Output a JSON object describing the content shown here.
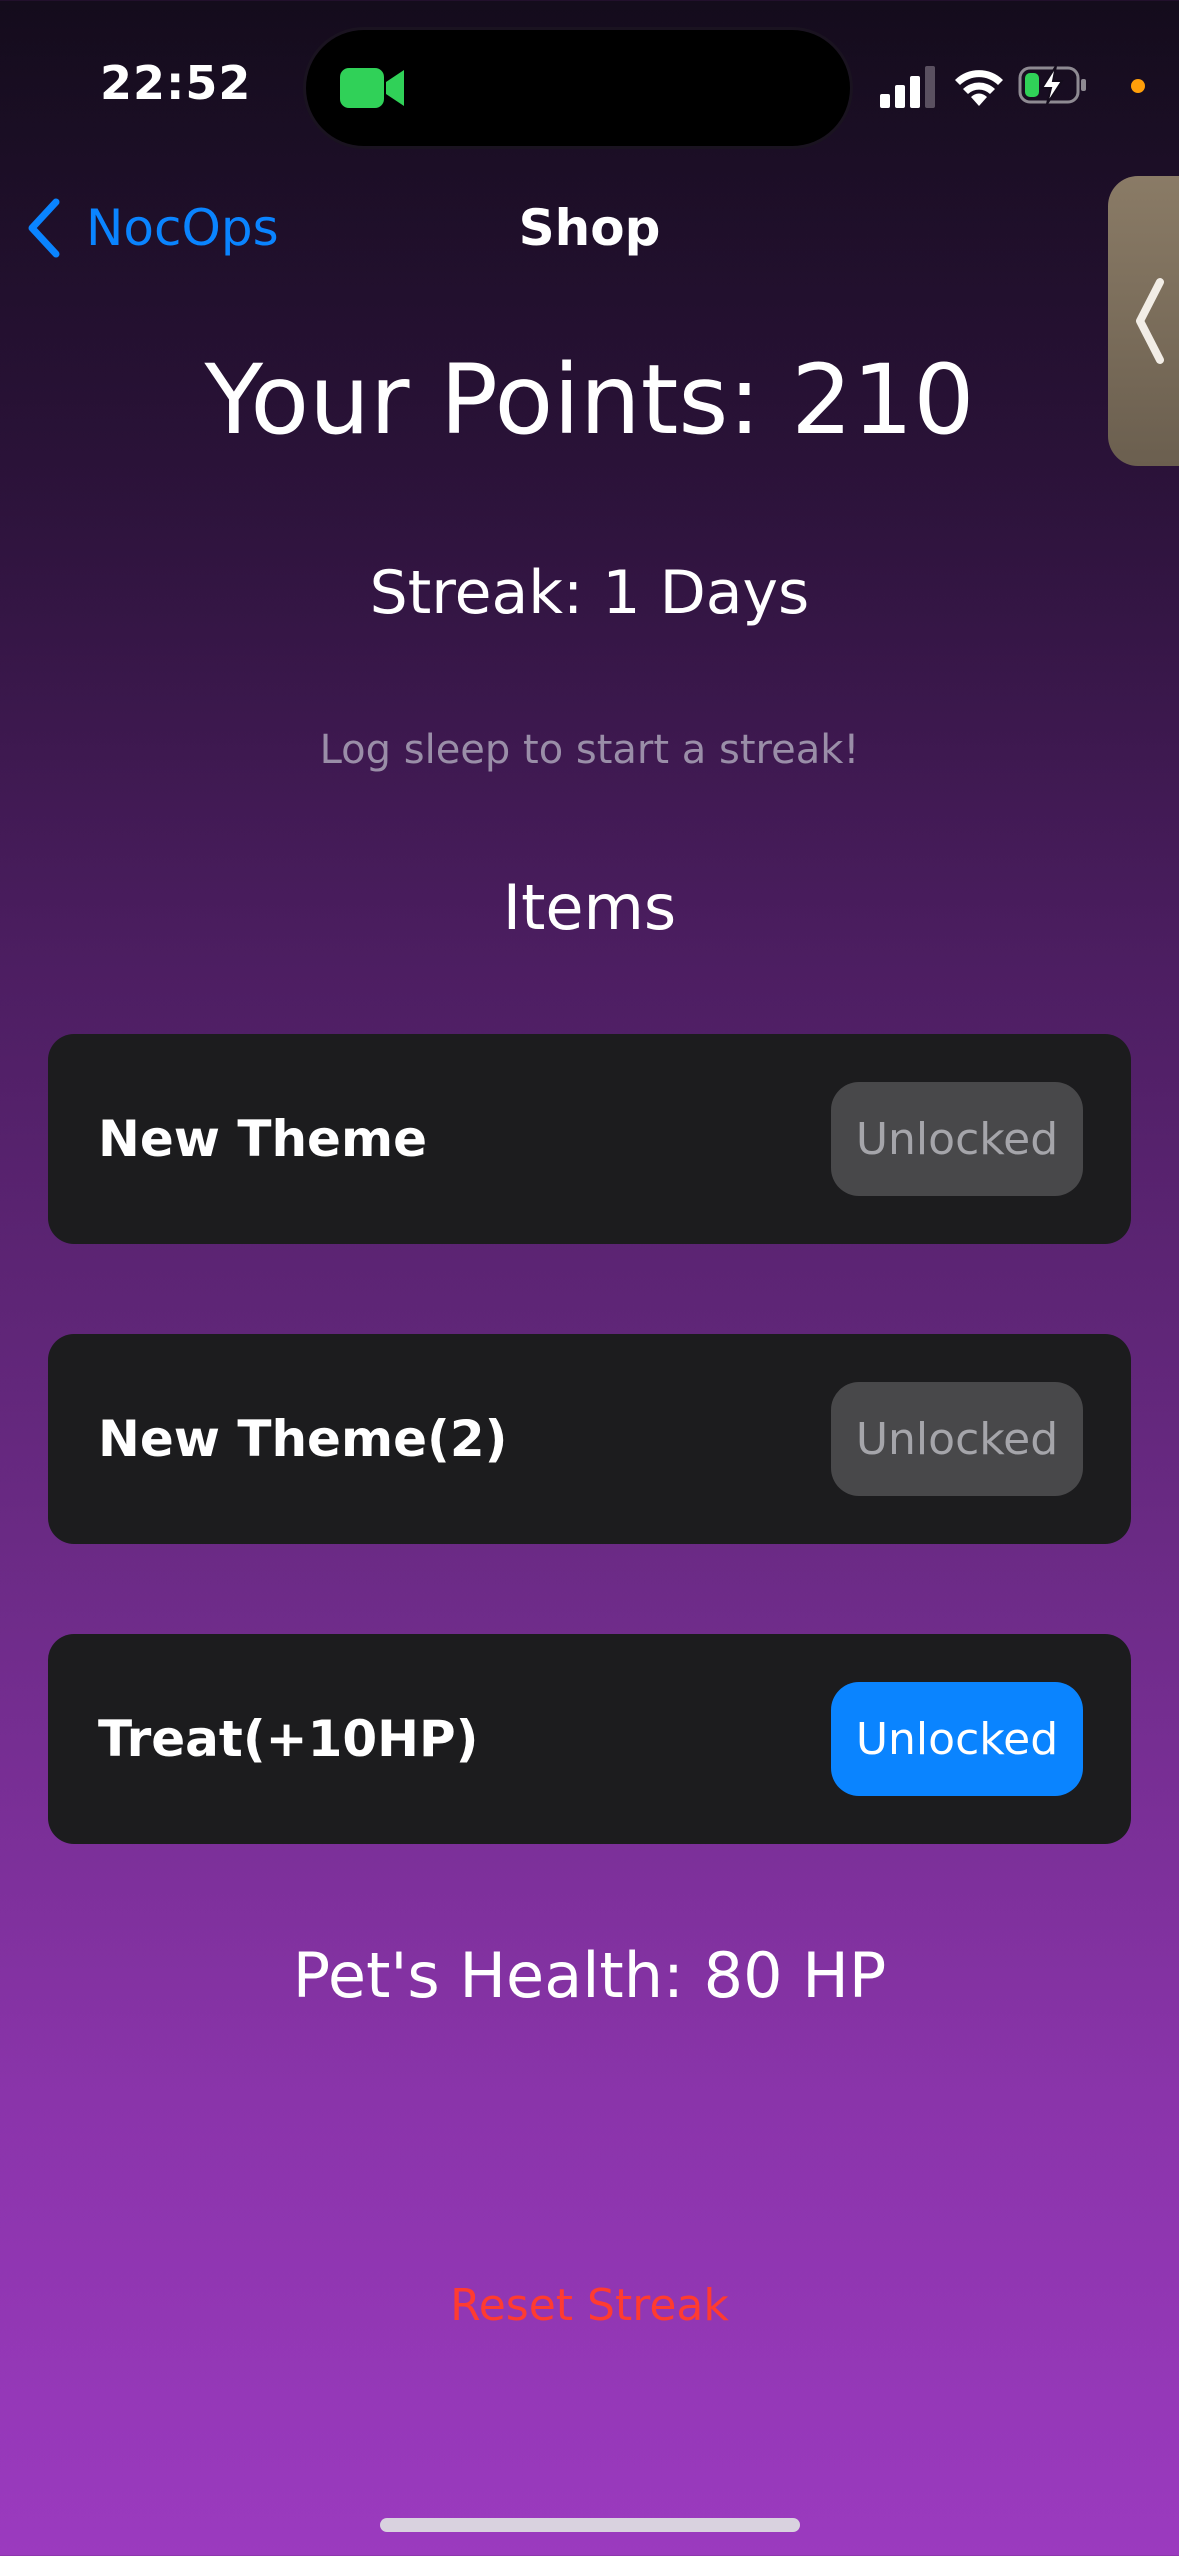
{
  "status_bar": {
    "time": "22:52"
  },
  "nav": {
    "back_label": "NocOps",
    "title": "Shop"
  },
  "points_text": "Your Points: 210",
  "streak_text": "Streak: 1 Days",
  "hint_text": "Log sleep to start a streak!",
  "items_heading": "Items",
  "items": [
    {
      "name": "New Theme",
      "button_label": "Unlocked",
      "button_state": "disabled"
    },
    {
      "name": "New Theme(2)",
      "button_label": "Unlocked",
      "button_state": "disabled"
    },
    {
      "name": "Treat(+10HP)",
      "button_label": "Unlocked",
      "button_state": "active"
    }
  ],
  "health_text": "Pet's Health: 80 HP",
  "reset_label": "Reset Streak",
  "colors": {
    "accent": "#0a84ff",
    "destructive": "#ff3b30",
    "card": "#1c1c1e"
  }
}
